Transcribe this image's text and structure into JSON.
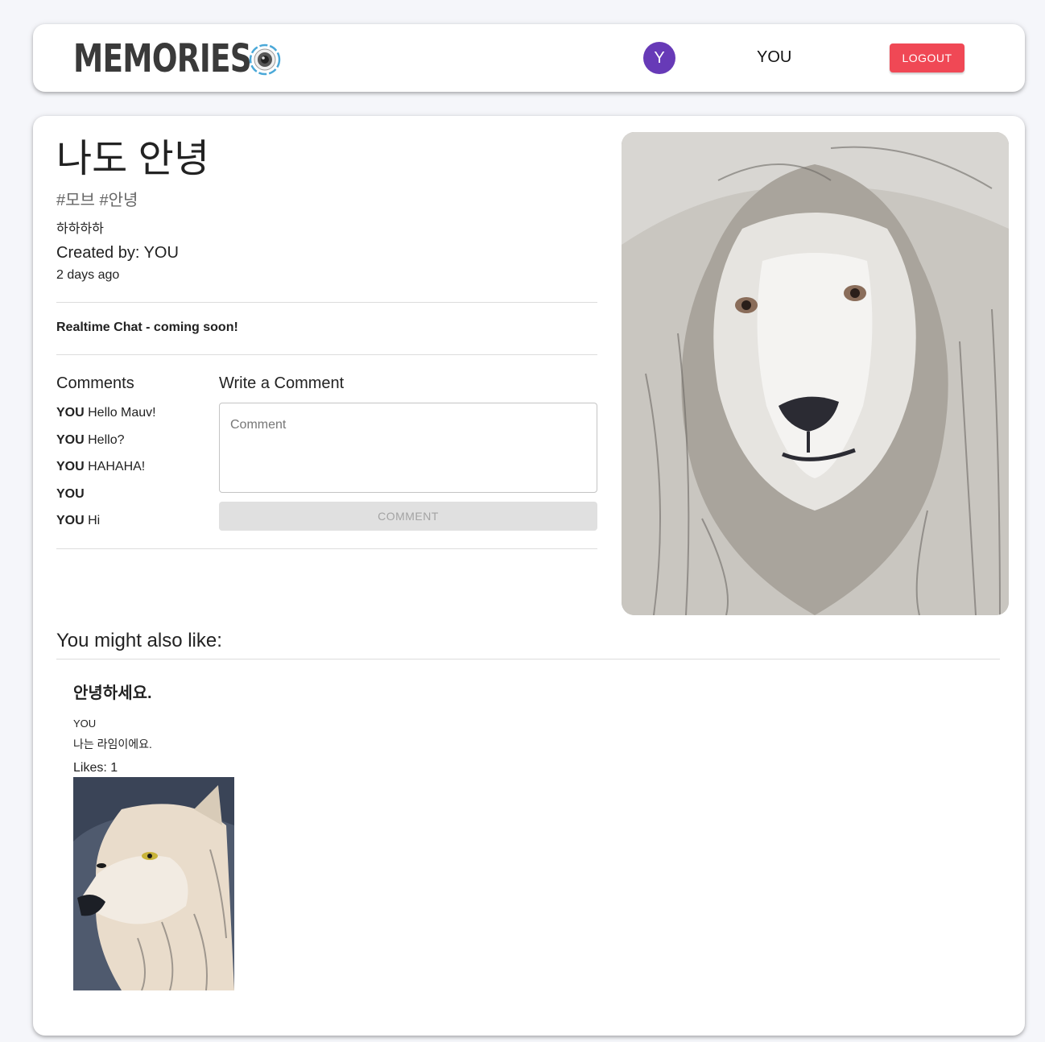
{
  "header": {
    "brand": "MEMORIES",
    "avatar_initial": "Y",
    "username": "YOU",
    "logout_label": "LOGOUT"
  },
  "post": {
    "title": "나도 안녕",
    "tags": "#모브 #안녕",
    "message": "하하하하",
    "created_by": "Created by: YOU",
    "time_ago": "2 days ago",
    "chat_notice": "Realtime Chat - coming soon!"
  },
  "comments": {
    "heading": "Comments",
    "items": [
      {
        "author": "YOU",
        "text": "Hello Mauv!"
      },
      {
        "author": "YOU",
        "text": "Hello?"
      },
      {
        "author": "YOU",
        "text": "HAHAHA!"
      },
      {
        "author": "YOU",
        "text": ""
      },
      {
        "author": "YOU",
        "text": "Hi"
      }
    ]
  },
  "write_comment": {
    "heading": "Write a Comment",
    "placeholder": "Comment",
    "button_label": "COMMENT"
  },
  "recommended": {
    "heading": "You might also like:",
    "items": [
      {
        "title": "안녕하세요.",
        "author": "YOU",
        "message": "나는 라임이에요.",
        "likes": "Likes: 1"
      }
    ]
  }
}
